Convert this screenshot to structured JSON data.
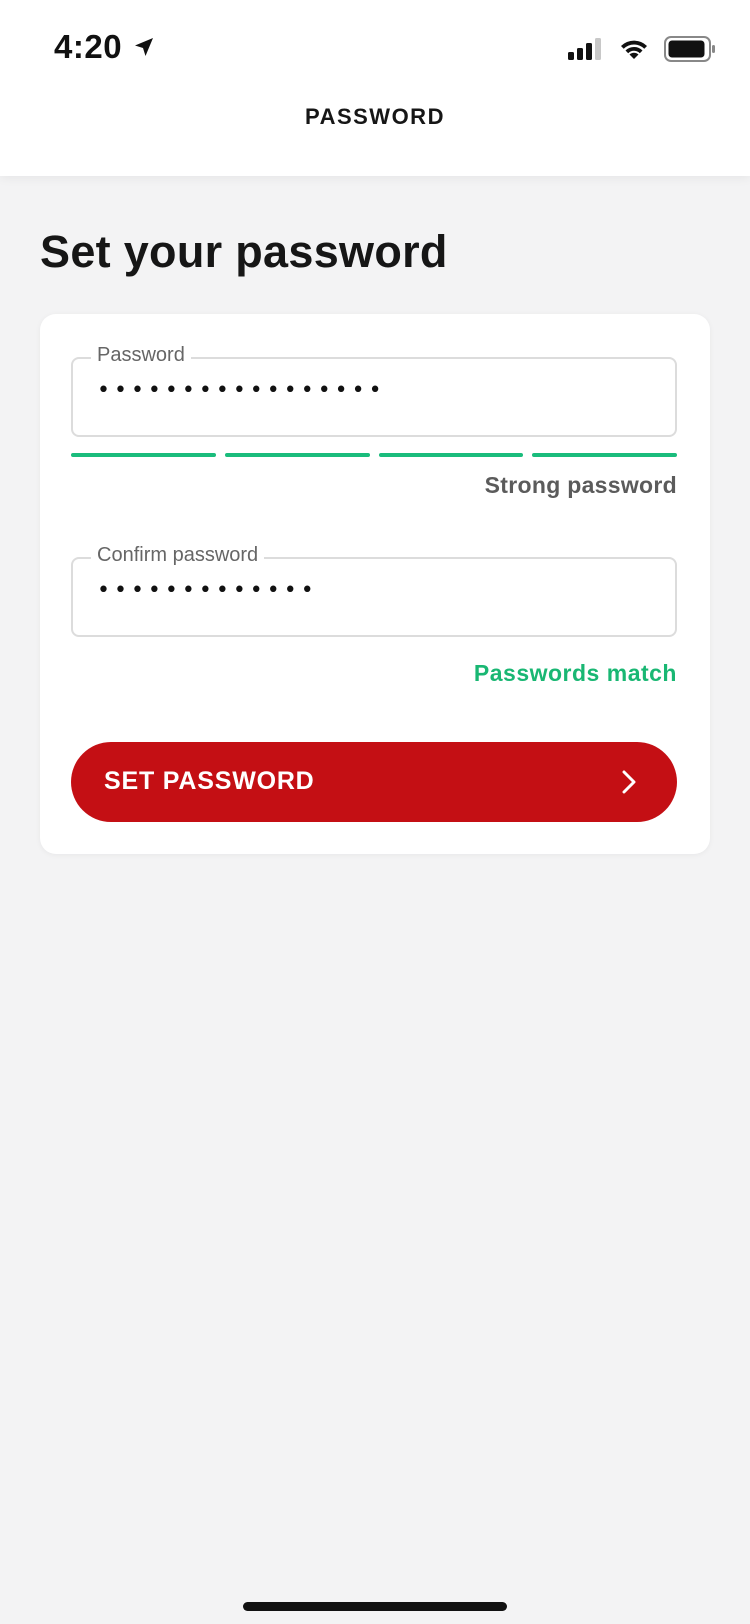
{
  "status_bar": {
    "time": "4:20",
    "icons": [
      "location-arrow-icon",
      "cellular-signal-icon",
      "wifi-icon",
      "battery-icon"
    ]
  },
  "nav": {
    "title": "PASSWORD"
  },
  "page": {
    "title": "Set your password"
  },
  "form": {
    "password": {
      "label": "Password",
      "value": "•••••••••••••••••"
    },
    "strength": {
      "segments_filled": 4,
      "segments_total": 4,
      "text": "Strong password",
      "color": "#1abc7c"
    },
    "confirm": {
      "label": "Confirm password",
      "value": "•••••••••••••"
    },
    "match": {
      "text": "Passwords match",
      "color": "#19b773"
    },
    "submit": {
      "label": "SET PASSWORD",
      "icon": "chevron-right-icon",
      "color": "#c40f14"
    }
  }
}
